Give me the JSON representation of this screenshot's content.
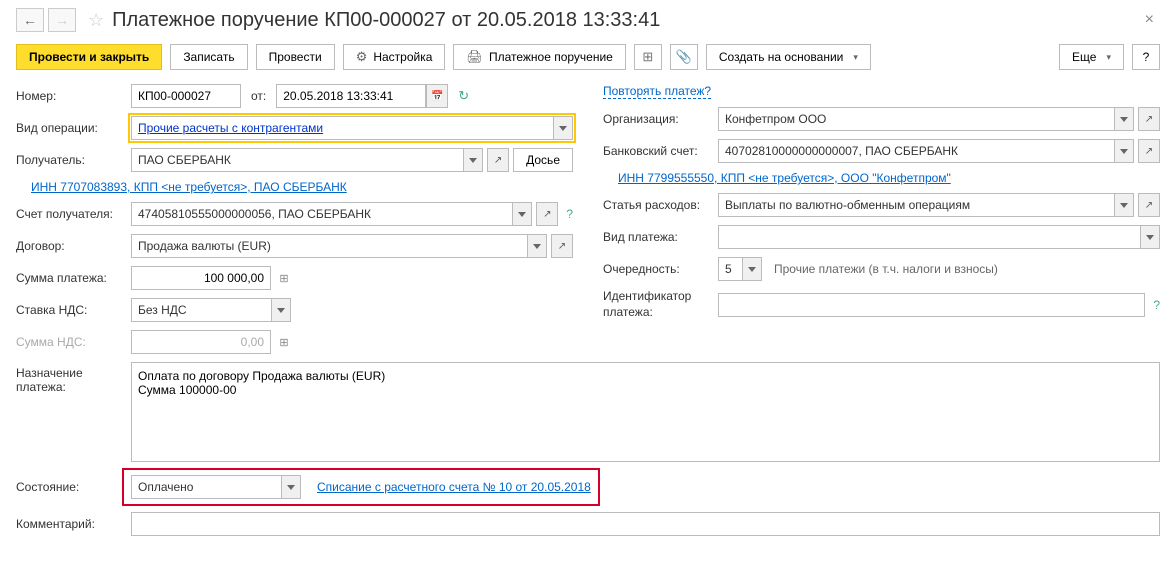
{
  "header": {
    "title": "Платежное поручение КП00-000027 от 20.05.2018 13:33:41"
  },
  "toolbar": {
    "post_close": "Провести и закрыть",
    "save": "Записать",
    "post": "Провести",
    "settings": "Настройка",
    "payment_order": "Платежное поручение",
    "create_based": "Создать на основании",
    "more": "Еще"
  },
  "left": {
    "number_lbl": "Номер:",
    "number_val": "КП00-000027",
    "from_lbl": "от:",
    "date_val": "20.05.2018 13:33:41",
    "op_type_lbl": "Вид операции:",
    "op_type_val": "Прочие расчеты с контрагентами",
    "recipient_lbl": "Получатель:",
    "recipient_val": "ПАО СБЕРБАНК",
    "dossier_btn": "Досье",
    "recipient_link": "ИНН 7707083893, КПП <не требуется>, ПАО СБЕРБАНК",
    "recip_acct_lbl": "Счет получателя:",
    "recip_acct_val": "47405810555000000056, ПАО СБЕРБАНК",
    "contract_lbl": "Договор:",
    "contract_val": "Продажа валюты (EUR)",
    "amount_lbl": "Сумма платежа:",
    "amount_val": "100 000,00",
    "vat_rate_lbl": "Ставка НДС:",
    "vat_rate_val": "Без НДС",
    "vat_sum_lbl": "Сумма НДС:",
    "vat_sum_val": "0,00"
  },
  "right": {
    "repeat_link": "Повторять платеж?",
    "org_lbl": "Организация:",
    "org_val": "Конфетпром ООО",
    "bank_acct_lbl": "Банковский счет:",
    "bank_acct_val": "40702810000000000007, ПАО СБЕРБАНК",
    "org_link": "ИНН 7799555550, КПП <не требуется>, ООО \"Конфетпром\"",
    "expense_lbl": "Статья расходов:",
    "expense_val": "Выплаты по валютно-обменным операциям",
    "pay_type_lbl": "Вид платежа:",
    "priority_lbl": "Очередность:",
    "priority_val": "5",
    "priority_txt": "Прочие платежи (в т.ч. налоги и взносы)",
    "ident_lbl": "Идентификатор платежа:"
  },
  "bottom": {
    "purpose_lbl": "Назначение платежа:",
    "purpose_val": "Оплата по договору Продажа валюты (EUR)\nСумма 100000-00",
    "status_lbl": "Состояние:",
    "status_val": "Оплачено",
    "status_link": "Списание с расчетного счета № 10 от 20.05.2018",
    "comment_lbl": "Комментарий:"
  }
}
